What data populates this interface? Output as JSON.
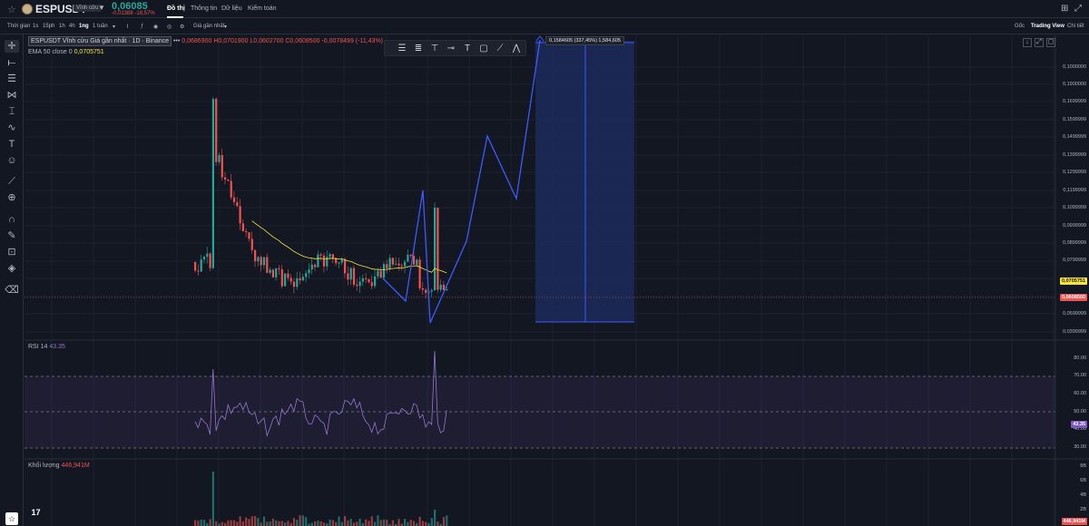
{
  "header": {
    "symbol": "ESPUSDT",
    "contract_badge": "Vĩnh cửu",
    "price": "0,06085",
    "change": "-0,01388 -18,57%",
    "nav": [
      "Đồ thị",
      "Thông tin",
      "Dữ liệu",
      "Kiểm toán"
    ],
    "active_nav": "Đồ thị"
  },
  "toolbar": {
    "time_label": "Thời gian",
    "intervals": [
      "1s",
      "15ph",
      "1h",
      "4h",
      "1ng",
      "1 tuần"
    ],
    "active_interval": "1ng",
    "price_mode": "Giá gần nhất",
    "right_tabs": [
      "Gốc",
      "Trading View",
      "Chi tiết"
    ],
    "active_right_tab": "Trading View"
  },
  "legend": {
    "title": "ESPUSDT Vĩnh cửu Giá gần nhất · 1D · Binance",
    "ohlc": "0,0686900 H0,0701900 L0,0602700 C0,0608500 -0,0078499 (-11,43%)",
    "ema_label": "EMA 50 close 0",
    "ema_value": "0,0705751",
    "rsi_label": "RSI 14",
    "rsi_value": "43.35",
    "vol_label": "Khối lượng",
    "vol_value": "446,941M"
  },
  "measure_label": "0,1584605 (337,45%) 1,584,605",
  "price_scale": {
    "labels": [
      "0,1000000",
      "0,1900000",
      "0,1699999",
      "0,1599999",
      "0,1499999",
      "0,1399999",
      "0,1299999",
      "0,1199999",
      "0,1099999",
      "0,0999999",
      "0,0899999",
      "0,0799999",
      "0,0599999",
      "0,0399999"
    ],
    "ema_tag": "0,0705751",
    "last_tag": "0,0608500"
  },
  "rsi_scale": {
    "labels": [
      "80.00",
      "70.00",
      "60.00",
      "50.00",
      "40.00",
      "30.00"
    ],
    "rsi_tag": "43.35"
  },
  "vol_scale": {
    "labels": [
      "8B",
      "6B",
      "4B",
      "2B"
    ],
    "vol_tag": "446,941M"
  },
  "colors": {
    "background": "#131722",
    "up": "#26a69a",
    "down": "#ef5350",
    "ema": "#f7e53b",
    "rsi": "#9575cd",
    "drawing": "#3d5afe",
    "measure_fill": "#1c2a5a"
  },
  "icons": {
    "left_tools": [
      "cursor-icon",
      "horizontal-line-icon",
      "channel-icon",
      "pitchfork-icon",
      "fib-icon",
      "brush-icon",
      "text-icon",
      "smile-icon",
      "ruler-icon",
      "zoom-icon",
      "magnet-icon",
      "pencil-lock-icon",
      "lock-icon",
      "eye-icon",
      "trash-icon"
    ],
    "draw_tools": [
      "fib-retracement-icon",
      "fib-channel-icon",
      "vertical-text-icon",
      "ray-icon",
      "text-icon",
      "rect-icon",
      "trend-line-icon",
      "path-icon"
    ]
  }
}
